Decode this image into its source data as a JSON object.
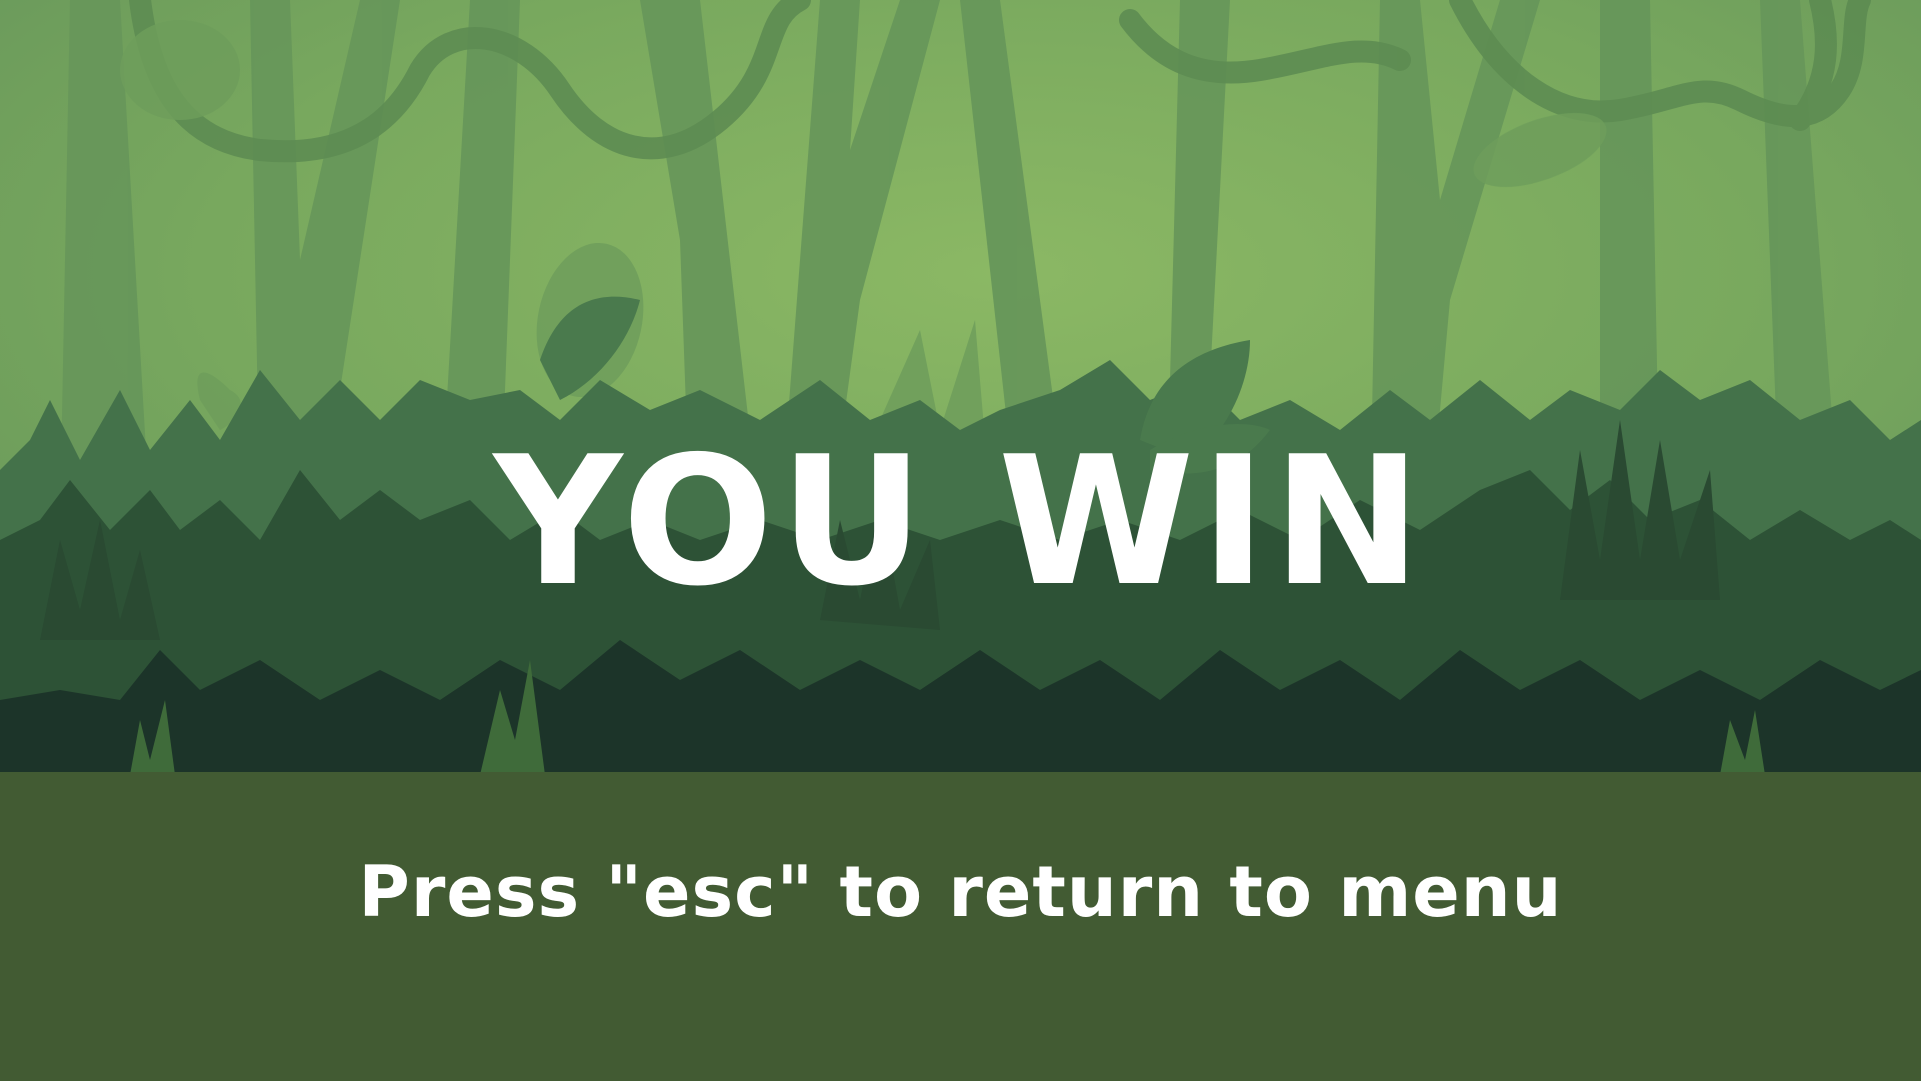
{
  "screen": {
    "title": "YOU WIN",
    "hint": "Press \"esc\" to return to menu"
  },
  "palette": {
    "sky_center": "#86b363",
    "sky_edge": "#6a9a5c",
    "tree_light": "#5f8f55",
    "foliage_mid": "#3e6b40",
    "foliage_dark": "#2a4f33",
    "foliage_darkest": "#1b3329",
    "ground": "#425b33",
    "text": "#ffffff"
  },
  "icons": [
    "jungle-background",
    "vine",
    "palm-leaf",
    "monstera-leaf"
  ]
}
